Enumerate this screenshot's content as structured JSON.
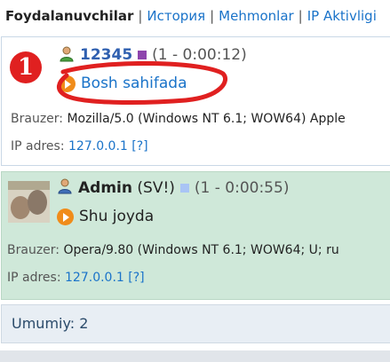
{
  "tabs": {
    "active": "Foydalanuvchilar",
    "separator": "|",
    "items": [
      "История",
      "Mehmonlar",
      "IP Aktivligi"
    ]
  },
  "users": [
    {
      "badge_number": "1",
      "name": "12345",
      "status_color": "#8e44ad",
      "session": "(1 - 0:00:12)",
      "location": "Bosh sahifada",
      "browser_label": "Brauzer:",
      "browser_value": "Mozilla/5.0 (Windows NT 6.1; WOW64) Apple",
      "ip_label": "IP adres:",
      "ip_value": "127.0.0.1",
      "ip_help": "[?]"
    },
    {
      "name": "Admin",
      "role": "(SV!)",
      "status_color": "#a9c4f5",
      "session": "(1 - 0:00:55)",
      "location": "Shu joyda",
      "browser_label": "Brauzer:",
      "browser_value": "Opera/9.80 (Windows NT 6.1; WOW64; U; ru",
      "ip_label": "IP adres:",
      "ip_value": "127.0.0.1",
      "ip_help": "[?]"
    }
  ],
  "summary": {
    "label": "Umumiy: 2"
  },
  "colors": {
    "link": "#1a73c9",
    "admin_row_bg": "#cfe8d9",
    "annotation_red": "#e02020",
    "location_icon": "#f08c1a"
  },
  "icons": [
    "user-icon",
    "admin-user-icon",
    "arrow-right-icon",
    "number-badge"
  ]
}
